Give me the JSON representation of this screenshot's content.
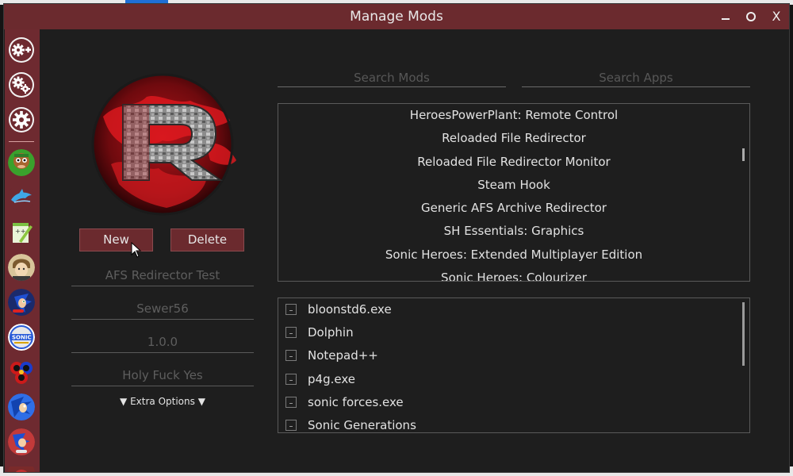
{
  "window": {
    "title": "Manage Mods",
    "minimize_icon": "minimize-icon",
    "maximize_icon": "maximize-icon",
    "close_label": "X"
  },
  "colors": {
    "accent": "#6b2a2e",
    "sidebar": "#6e2a30",
    "background": "#1e1e1e",
    "text": "#e2e2e2",
    "placeholder": "#5e5e5e"
  },
  "sidebar": {
    "tools": [
      {
        "icon": "add-gear-icon"
      },
      {
        "icon": "gears-icon"
      },
      {
        "icon": "settings-gear-icon"
      }
    ],
    "apps": [
      {
        "icon": "bloons-icon"
      },
      {
        "icon": "dolphin-icon"
      },
      {
        "icon": "notepad-plus-plus-icon"
      },
      {
        "icon": "persona-icon"
      },
      {
        "icon": "sonic-forces-icon"
      },
      {
        "icon": "sonic-generations-icon"
      },
      {
        "icon": "sonic-heroes-icon"
      },
      {
        "icon": "sonic-icon-blue"
      },
      {
        "icon": "sonic-icon-mania"
      },
      {
        "icon": "partial-app-icon"
      }
    ]
  },
  "mod_editor": {
    "logo": "reloaded-logo",
    "new_label": "New",
    "delete_label": "Delete",
    "name_field": "AFS Redirector Test",
    "author_field": "Sewer56",
    "version_field": "1.0.0",
    "description_field": "Holy Fuck Yes",
    "extra_options_label": "▼ Extra Options ▼"
  },
  "search": {
    "mods_placeholder": "Search Mods",
    "apps_placeholder": "Search Apps"
  },
  "mods": [
    "HeroesPowerPlant: Remote Control",
    "Reloaded File Redirector",
    "Reloaded File Redirector Monitor",
    "Steam Hook",
    "Generic AFS Archive Redirector",
    "SH Essentials: Graphics",
    "Sonic Heroes: Extended Multiplayer Edition",
    "Sonic Heroes: Colourizer"
  ],
  "apps": [
    {
      "name": "bloonstd6.exe",
      "checked": false
    },
    {
      "name": "Dolphin",
      "checked": false
    },
    {
      "name": "Notepad++",
      "checked": false
    },
    {
      "name": "p4g.exe",
      "checked": false
    },
    {
      "name": "sonic forces.exe",
      "checked": false
    },
    {
      "name": "Sonic Generations",
      "checked": false
    }
  ]
}
